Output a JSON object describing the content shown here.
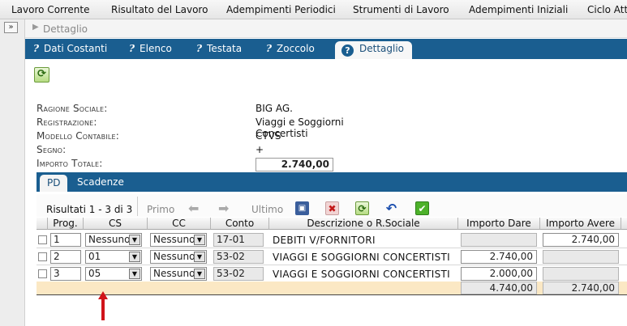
{
  "menu": [
    "Lavoro Corrente",
    "Risultato del Lavoro",
    "Adempimenti Periodici",
    "Strumenti di Lavoro",
    "Adempimenti Iniziali",
    "Ciclo Atti"
  ],
  "collapse_label": "»",
  "breadcrumb": {
    "arrow": "▶",
    "label": "Dettaglio"
  },
  "tabs": [
    {
      "label": "Dati Costanti"
    },
    {
      "label": "Elenco"
    },
    {
      "label": "Testata"
    },
    {
      "label": "Zoccolo"
    },
    {
      "label": "Dettaglio",
      "active": true
    }
  ],
  "tab_glyph": "?",
  "info": {
    "ragione_sociale_label": "Ragione Sociale:",
    "ragione_sociale": "BIG AG.",
    "registrazione_label": "Registrazione:",
    "registrazione": "Viaggi e Soggiorni Concertisti",
    "modello_label": "Modello Contabile:",
    "modello": "CTVS",
    "segno_label": "Segno:",
    "segno": "+",
    "importo_label": "Importo Totale:",
    "importo": "2.740,00"
  },
  "subtabs": [
    "PD",
    "Scadenze"
  ],
  "grid_toolbar": {
    "results": "Risultati 1 - 3 di 3",
    "first": "Primo",
    "last": "Ultimo"
  },
  "columns": [
    "Prog.",
    "CS",
    "CC",
    "Conto",
    "Descrizione o R.Sociale",
    "Importo Dare",
    "Importo Avere"
  ],
  "rows": [
    {
      "prog": "1",
      "cs": "Nessuno",
      "cc": "Nessuno",
      "conto": "17-01",
      "desc": "DEBITI V/FORNITORI",
      "dare": "",
      "avere": "2.740,00"
    },
    {
      "prog": "2",
      "cs": "01",
      "cc": "Nessuno",
      "conto": "53-02",
      "desc": "VIAGGI E SOGGIORNI CONCERTISTI",
      "dare": "2.740,00",
      "avere": ""
    },
    {
      "prog": "3",
      "cs": "05",
      "cc": "Nessuno",
      "conto": "53-02",
      "desc": "VIAGGI E SOGGIORNI CONCERTISTI",
      "dare": "2.000,00",
      "avere": ""
    }
  ],
  "totals": {
    "dare": "4.740,00",
    "avere": "2.740,00"
  },
  "colors": {
    "tab_bar": "#1a5e90",
    "totals_row": "#fbe8c4",
    "marker_arrow": "#d0141a"
  }
}
